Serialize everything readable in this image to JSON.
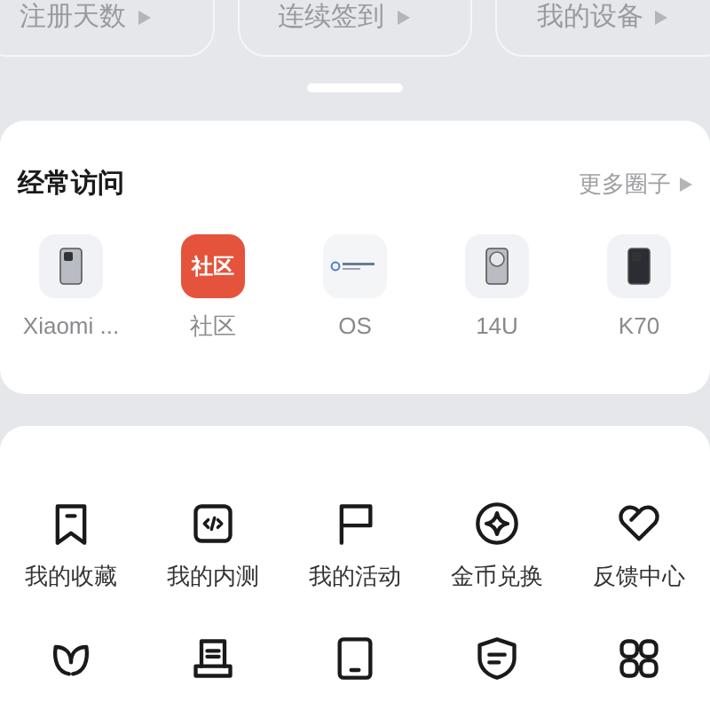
{
  "stats": [
    {
      "label": "注册天数"
    },
    {
      "label": "连续签到"
    },
    {
      "label": "我的设备"
    }
  ],
  "frequent": {
    "title": "经常访问",
    "more": "更多圈子",
    "items": [
      {
        "kind": "phone",
        "label": "Xiaomi ..."
      },
      {
        "kind": "community",
        "badge": "社区",
        "label": "社区"
      },
      {
        "kind": "os",
        "label": "OS"
      },
      {
        "kind": "phone-round",
        "label": "14U"
      },
      {
        "kind": "phone-dark",
        "label": "K70"
      }
    ]
  },
  "tools": [
    {
      "kind": "bookmark",
      "label": "我的收藏"
    },
    {
      "kind": "code",
      "label": "我的内测"
    },
    {
      "kind": "flag",
      "label": "我的活动"
    },
    {
      "kind": "coin",
      "label": "金币兑换"
    },
    {
      "kind": "heart",
      "label": "反馈中心"
    },
    {
      "kind": "leaf"
    },
    {
      "kind": "scroll"
    },
    {
      "kind": "tablet"
    },
    {
      "kind": "shield"
    },
    {
      "kind": "grid"
    }
  ]
}
